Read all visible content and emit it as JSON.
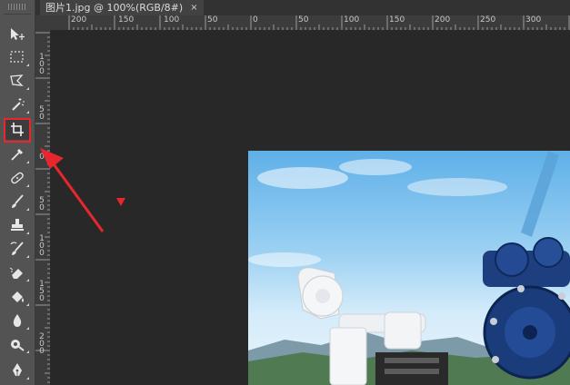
{
  "document_tab": {
    "title": "图片1.jpg @ 100%(RGB/8#)",
    "close_symbol": "×"
  },
  "ruler_horizontal": {
    "labels": [
      "200",
      "150",
      "100",
      "50",
      "0",
      "50",
      "100",
      "150",
      "200",
      "250",
      "300"
    ]
  },
  "ruler_vertical": {
    "labels": [
      "1 0 0",
      "5 0",
      "0",
      "5 0",
      "1 0 0",
      "1 5 0",
      "2 0 0"
    ]
  },
  "tools": [
    {
      "name": "move-tool",
      "icon": "move-icon"
    },
    {
      "name": "marquee-tool",
      "icon": "rect-marquee-icon"
    },
    {
      "name": "lasso-tool",
      "icon": "polygon-lasso-icon"
    },
    {
      "name": "magic-wand-tool",
      "icon": "magic-wand-icon"
    },
    {
      "name": "crop-tool",
      "icon": "crop-icon",
      "active": true
    },
    {
      "name": "eyedropper-tool",
      "icon": "eyedropper-icon"
    },
    {
      "name": "healing-brush-tool",
      "icon": "bandage-icon"
    },
    {
      "name": "brush-tool",
      "icon": "brush-icon"
    },
    {
      "name": "clone-stamp-tool",
      "icon": "stamp-icon"
    },
    {
      "name": "history-brush-tool",
      "icon": "history-brush-icon"
    },
    {
      "name": "eraser-tool",
      "icon": "eraser-icon"
    },
    {
      "name": "paint-bucket-tool",
      "icon": "paint-bucket-icon"
    },
    {
      "name": "blur-tool",
      "icon": "drop-icon"
    },
    {
      "name": "dodge-tool",
      "icon": "dodge-icon"
    },
    {
      "name": "pen-tool",
      "icon": "pen-icon"
    }
  ],
  "colors": {
    "highlight": "#e8262d",
    "panel": "#535353",
    "canvas": "#282828",
    "ruler": "#3c3c3c"
  }
}
